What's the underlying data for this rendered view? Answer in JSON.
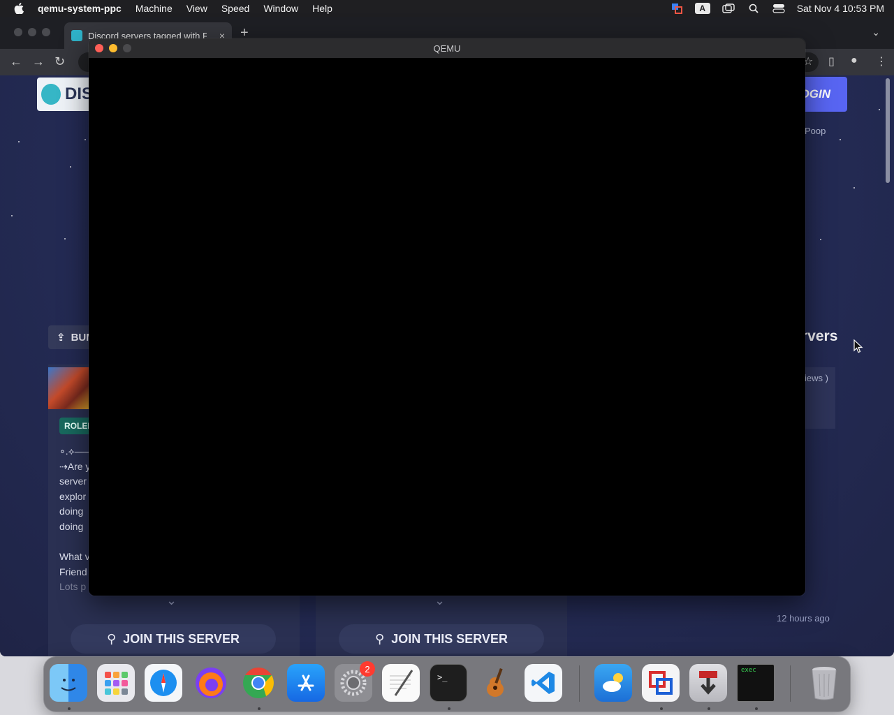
{
  "menubar": {
    "app_name": "qemu-system-ppc",
    "items": [
      "Machine",
      "View",
      "Speed",
      "Window",
      "Help"
    ],
    "input_source": "A",
    "clock": "Sat Nov 4  10:53 PM"
  },
  "browser": {
    "tab_title": "Discord servers tagged with F",
    "tab_close": "×",
    "new_tab": "+"
  },
  "page": {
    "logo_text": "DIS",
    "login_label": "OGIN",
    "user_text": "Poop",
    "bump_label": "BUM",
    "servers_heading": "rvers",
    "reviews_text": "iews )",
    "tag_label": "ROLEI",
    "description_lines": [
      "∘.⟡——",
      "⇢Are y",
      "server",
      "explor",
      "doing",
      "doing",
      "",
      "What v",
      "Friend",
      "Lots p"
    ],
    "join_label": "JOIN THIS SERVER",
    "time_ago": "12 hours ago"
  },
  "qemu": {
    "title": "QEMU"
  },
  "dock": {
    "apps": [
      "finder-icon",
      "launchpad-icon",
      "safari-icon",
      "firefox-icon",
      "chrome-icon",
      "app-store-icon",
      "system-settings-icon",
      "textedit-icon",
      "terminal-icon",
      "garageband-icon",
      "vscode-icon",
      "weather-icon",
      "parallels-icon",
      "installer-icon",
      "exec-window-icon",
      "trash-icon"
    ],
    "settings_badge": "2",
    "exec_label": "exec"
  }
}
